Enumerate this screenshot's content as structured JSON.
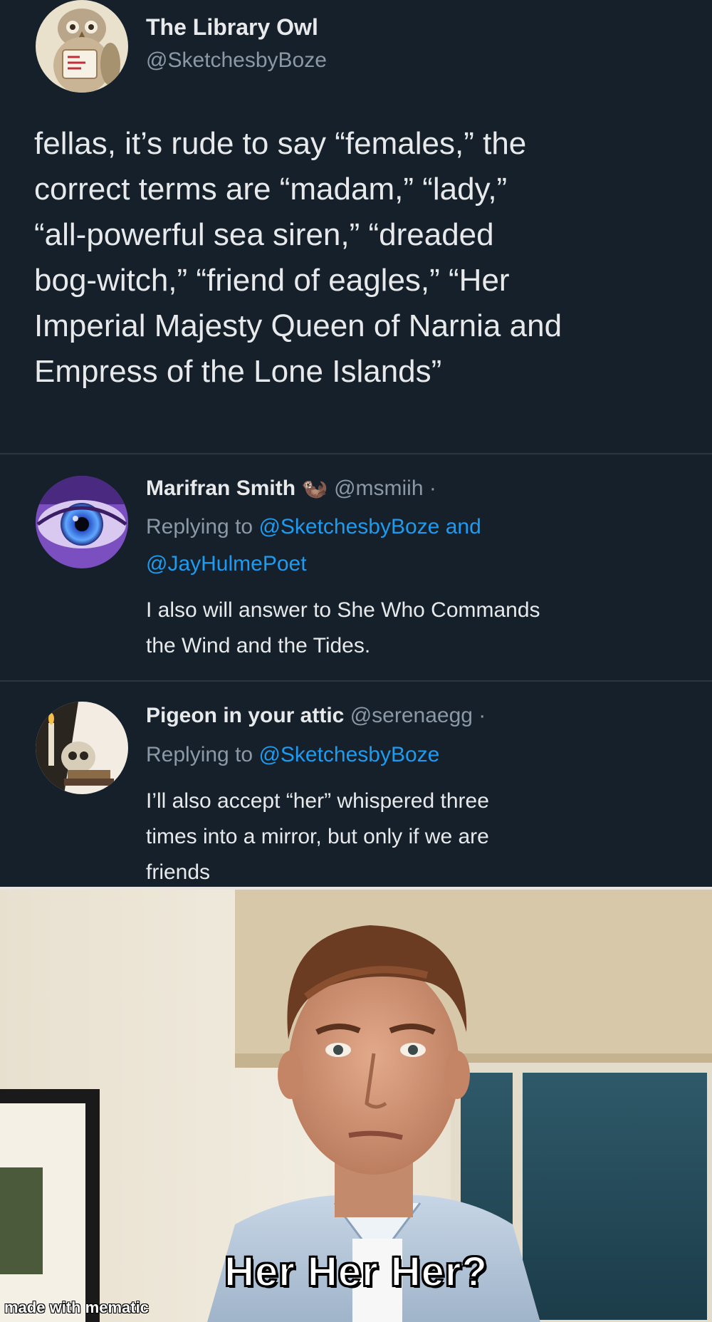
{
  "main_tweet": {
    "author_name": "The Library Owl",
    "author_handle": "@SketchesbyBoze",
    "avatar_icon": "owl-reading-avatar",
    "text_lines": [
      "fellas, it’s rude to say “females,” the",
      "correct terms are “madam,” “lady,”",
      "“all-powerful sea siren,” “dreaded",
      "bog-witch,” “friend of eagles,” “Her",
      "Imperial Majesty Queen of Narnia and",
      "Empress of the Lone Islands”"
    ]
  },
  "replies": [
    {
      "author_name": "Marifran Smith",
      "author_emoji": "🦦",
      "author_handle": "@msmiih ·",
      "avatar_icon": "blue-eye-avatar",
      "replying_prefix": "Replying to",
      "replying_mention_1": "@SketchesbyBoze",
      "replying_joiner": "and",
      "replying_mention_2": "@JayHulmePoet",
      "text_lines": [
        "I also will answer to She Who Commands",
        "the Wind and the Tides."
      ]
    },
    {
      "author_name": "Pigeon in your attic",
      "author_handle": "@serenaegg ·",
      "avatar_icon": "skull-candle-avatar",
      "replying_prefix": "Replying to",
      "replying_mention_1": "@SketchesbyBoze",
      "text_lines": [
        "I’ll also accept “her” whispered three",
        "times into a mirror, but only if we are",
        "friends"
      ]
    }
  ],
  "meme": {
    "caption": "Her Her Her?",
    "watermark": "made with mematic"
  },
  "colors": {
    "background": "#15202b",
    "text_primary": "#e7e9ea",
    "text_secondary": "#8b98a5",
    "link": "#1d9bf0"
  }
}
